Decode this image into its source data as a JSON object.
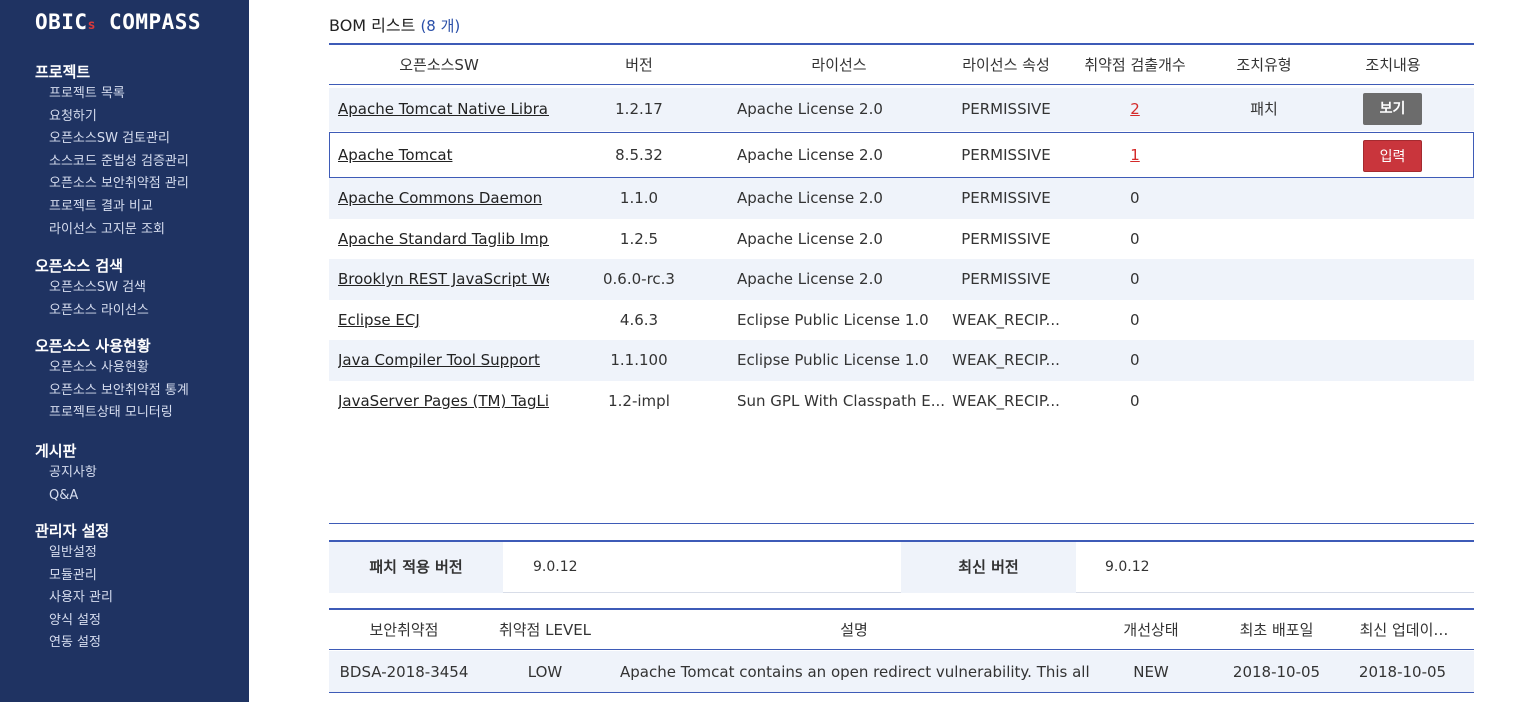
{
  "sidebar": {
    "logo_left": "OBIC",
    "logo_s": "s",
    "logo_right": " COMPASS",
    "groups": [
      {
        "title": "프로젝트",
        "items": [
          "프로젝트 목록",
          "요청하기",
          "오픈소스SW 검토관리",
          "소스코드 준법성 검증관리",
          "오픈소스 보안취약점 관리",
          "프로젝트 결과 비교",
          "라이선스 고지문 조회"
        ]
      },
      {
        "title": "오픈소스 검색",
        "items": [
          "오픈소스SW 검색",
          "오픈소스 라이선스"
        ]
      },
      {
        "title": "오픈소스 사용현황",
        "items": [
          "오픈소스 사용현황",
          "오픈소스 보안취약점 통계",
          "프로젝트상태 모니터링"
        ]
      },
      {
        "title": "게시판",
        "items": [
          "공지사항",
          "Q&A"
        ]
      },
      {
        "title": "관리자 설정",
        "items": [
          "일반설정",
          "모듈관리",
          "사용자 관리",
          "양식 설정",
          "연동 설정"
        ]
      }
    ]
  },
  "bom": {
    "title": "BOM 리스트",
    "count": "(8 개)",
    "columns": [
      "오픈소스SW",
      "버전",
      "라이선스",
      "라이선스 속성",
      "취약점 검출개수",
      "조치유형",
      "조치내용"
    ],
    "rows": [
      {
        "name": "Apache Tomcat Native Library",
        "version": "1.2.17",
        "license": "Apache License 2.0",
        "attr": "PERMISSIVE",
        "vulns": "2",
        "action_type": "패치",
        "action": "보기"
      },
      {
        "name": "Apache Tomcat",
        "version": "8.5.32",
        "license": "Apache License 2.0",
        "attr": "PERMISSIVE",
        "vulns": "1",
        "action_type": "",
        "action": "입력"
      },
      {
        "name": "Apache Commons Daemon",
        "version": "1.1.0",
        "license": "Apache License 2.0",
        "attr": "PERMISSIVE",
        "vulns": "0",
        "action_type": "",
        "action": ""
      },
      {
        "name": "Apache Standard Taglib Implementation",
        "version": "1.2.5",
        "license": "Apache License 2.0",
        "attr": "PERMISSIVE",
        "vulns": "0",
        "action_type": "",
        "action": ""
      },
      {
        "name": "Brooklyn REST JavaScript Web GUI",
        "version": "0.6.0-rc.3",
        "license": "Apache License 2.0",
        "attr": "PERMISSIVE",
        "vulns": "0",
        "action_type": "",
        "action": ""
      },
      {
        "name": "Eclipse ECJ",
        "version": "4.6.3",
        "license": "Eclipse Public License 1.0",
        "attr": "WEAK_RECIP...",
        "vulns": "0",
        "action_type": "",
        "action": ""
      },
      {
        "name": "Java Compiler Tool Support",
        "version": "1.1.100",
        "license": "Eclipse Public License 1.0",
        "attr": "WEAK_RECIP...",
        "vulns": "0",
        "action_type": "",
        "action": ""
      },
      {
        "name": "JavaServer Pages (TM) TagLib",
        "version": "1.2-impl",
        "license": "Sun GPL With Classpath E...",
        "attr": "WEAK_RECIP...",
        "vulns": "0",
        "action_type": "",
        "action": ""
      }
    ]
  },
  "patch": {
    "applied_label": "패치 적용 버전",
    "applied_value": "9.0.12",
    "latest_label": "최신 버전",
    "latest_value": "9.0.12"
  },
  "security": {
    "columns": [
      "보안취약점",
      "취약점 LEVEL",
      "설명",
      "개선상태",
      "최초 배포일",
      "최신 업데이…"
    ],
    "rows": [
      {
        "id": "BDSA-2018-3454",
        "level": "LOW",
        "desc": "Apache Tomcat contains an open redirect vulnerability.  This all...",
        "status": "NEW",
        "first": "2018-10-05",
        "latest": "2018-10-05"
      }
    ]
  },
  "colors": {
    "sidebar_bg": "#1f3362",
    "accent": "#3e5bb7",
    "alert_red": "#d42a2a",
    "row_alt": "#eff3fa"
  }
}
